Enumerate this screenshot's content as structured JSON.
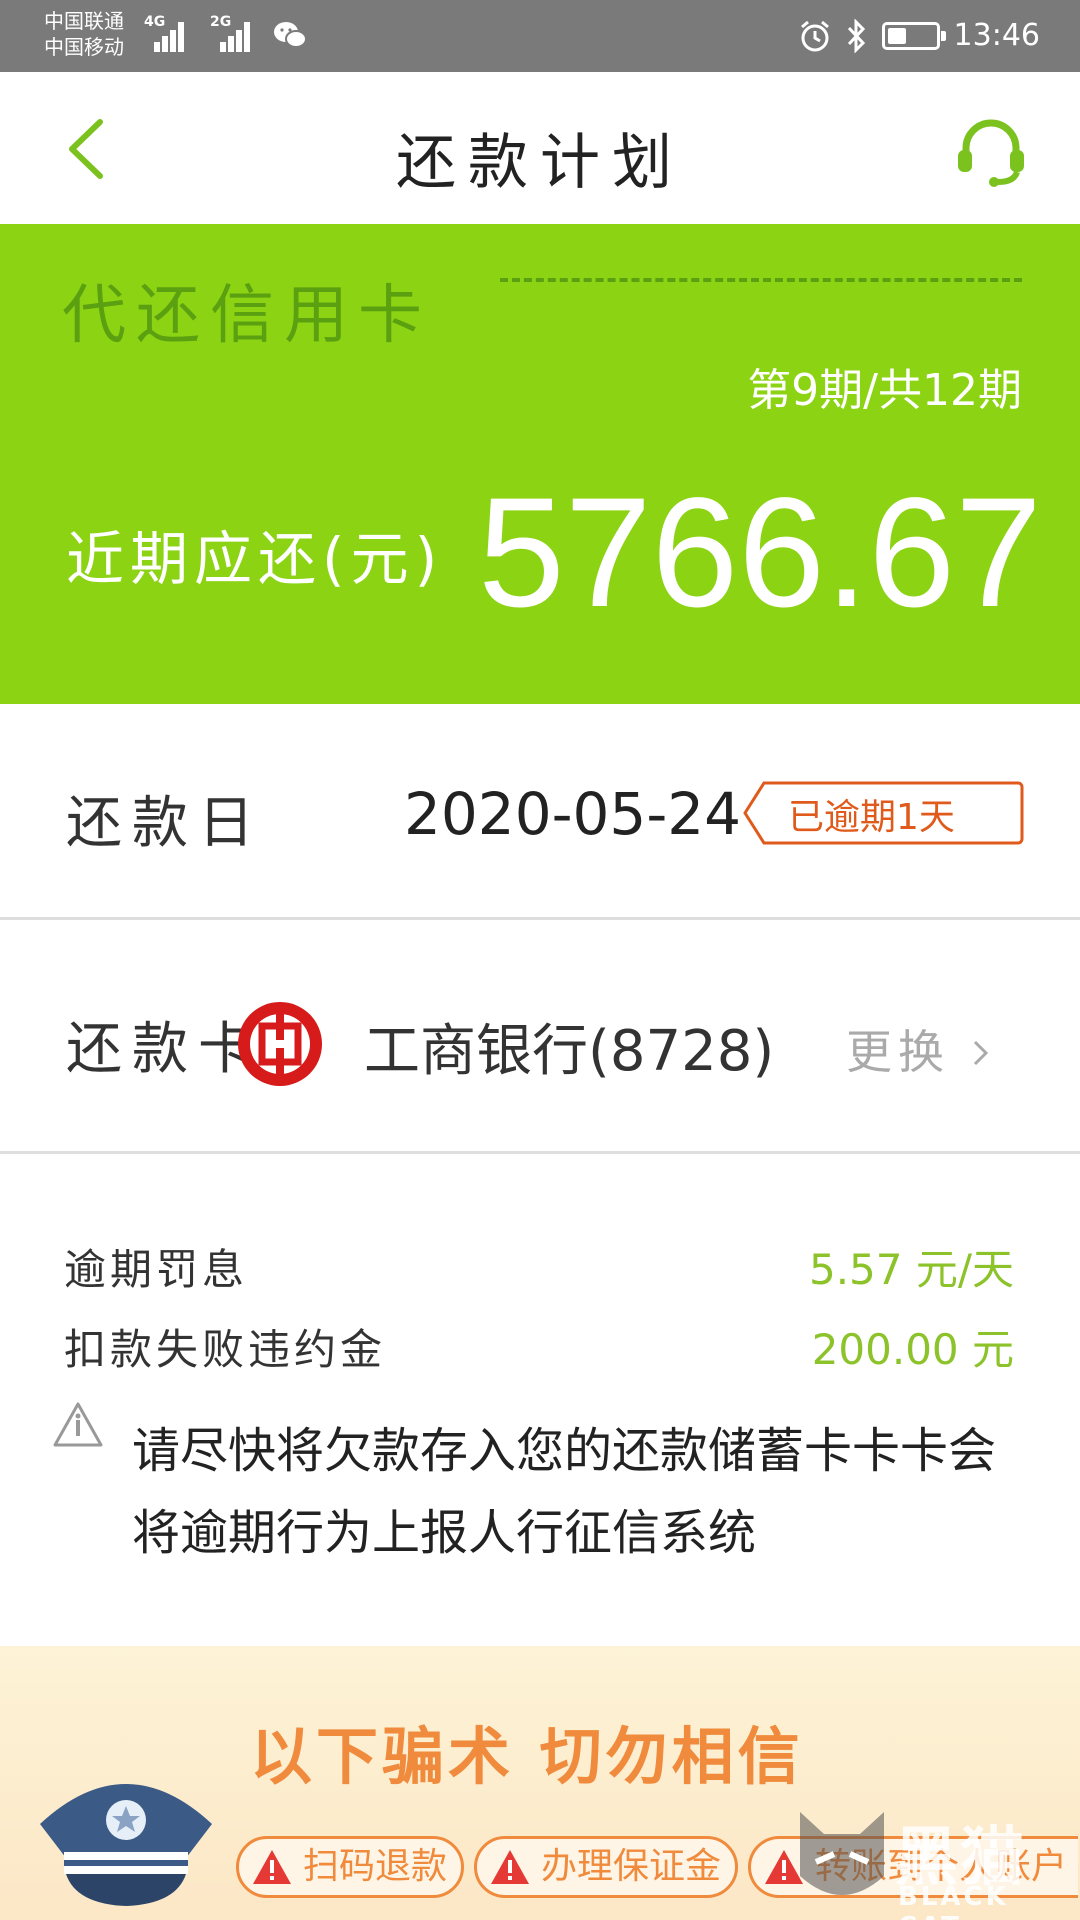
{
  "status_bar": {
    "carrier_1": "中国联通",
    "carrier_2": "中国移动",
    "network_1": "4G",
    "network_2": "2G",
    "time": "13:46",
    "battery_level": 0.35
  },
  "nav": {
    "title": "还款计划"
  },
  "banner": {
    "card_type": "代还信用卡",
    "period": "第9期/共12期",
    "due_label": "近期应还(元)",
    "due_amount": "5766.67"
  },
  "repay_date": {
    "label": "还款日",
    "value": "2020-05-24",
    "status_tag": "已逾期1天"
  },
  "repay_card": {
    "label": "还款卡",
    "bank": "工商银行(8728)",
    "change_label": "更换"
  },
  "fees": [
    {
      "label": "逾期罚息",
      "value": "5.57 元/天"
    },
    {
      "label": "扣款失败违约金",
      "value": "200.00 元"
    }
  ],
  "warning": {
    "text": "请尽快将欠款存入您的还款储蓄卡卡卡会将逾期行为上报人行征信系统"
  },
  "ad": {
    "title": "以下骗术 切勿相信",
    "items": [
      "扫码退款",
      "办理保证金",
      "转账到个人账户"
    ]
  },
  "watermark": {
    "name": "黑猫",
    "sub": "BLACK CAT"
  },
  "colors": {
    "banner_green": "#8cd313",
    "accent_green": "#7cc21e",
    "overdue_orange": "#e05a1c",
    "ad_orange": "#f08a3c"
  }
}
